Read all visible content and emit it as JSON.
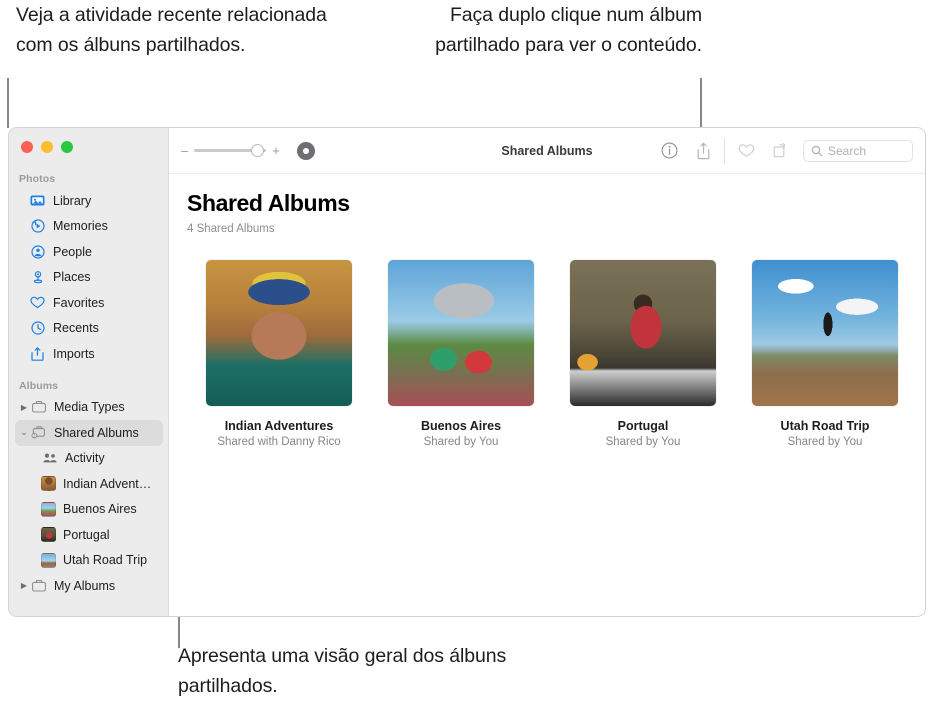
{
  "callouts": {
    "activity": "Veja a atividade recente relacionada com os álbuns partilhados.",
    "double_click": "Faça duplo clique num álbum partilhado para ver o conteúdo.",
    "overview": "Apresenta uma visão geral dos álbuns partilhados."
  },
  "window": {
    "traffic_lights": {
      "close_color": "#ff5f57",
      "minimize_color": "#febc2e",
      "zoom_color": "#28c840"
    }
  },
  "sidebar": {
    "sections": [
      {
        "header": "Photos",
        "items": [
          {
            "label": "Library",
            "icon": "library-icon",
            "selected": false
          },
          {
            "label": "Memories",
            "icon": "memories-icon",
            "selected": false
          },
          {
            "label": "People",
            "icon": "people-icon",
            "selected": false
          },
          {
            "label": "Places",
            "icon": "places-icon",
            "selected": false
          },
          {
            "label": "Favorites",
            "icon": "heart-icon",
            "selected": false
          },
          {
            "label": "Recents",
            "icon": "clock-icon",
            "selected": false
          },
          {
            "label": "Imports",
            "icon": "import-icon",
            "selected": false
          }
        ]
      },
      {
        "header": "Albums",
        "items": [
          {
            "label": "Media Types",
            "icon": "folder-icon",
            "twisty": "▶",
            "selected": false
          },
          {
            "label": "Shared Albums",
            "icon": "shared-folder-icon",
            "twisty": "⌄",
            "selected": true
          },
          {
            "label": "Activity",
            "icon": "activity-icon",
            "sub": true,
            "selected": false
          },
          {
            "label": "Indian Advent…",
            "icon": "album-thumb",
            "sub": true,
            "selected": false
          },
          {
            "label": "Buenos Aires",
            "icon": "album-thumb",
            "sub": true,
            "selected": false
          },
          {
            "label": "Portugal",
            "icon": "album-thumb",
            "sub": true,
            "selected": false
          },
          {
            "label": "Utah Road Trip",
            "icon": "album-thumb",
            "sub": true,
            "selected": false
          },
          {
            "label": "My Albums",
            "icon": "folder-icon",
            "twisty": "▶",
            "selected": false
          }
        ]
      }
    ]
  },
  "toolbar": {
    "zoom_out_label": "–",
    "zoom_in_label": "+",
    "title": "Shared Albums",
    "search_placeholder": "Search"
  },
  "main": {
    "title": "Shared Albums",
    "subtitle": "4 Shared Albums",
    "albums": [
      {
        "name": "Indian Adventures",
        "shared": "Shared with Danny Rico"
      },
      {
        "name": "Buenos Aires",
        "shared": "Shared by You"
      },
      {
        "name": "Portugal",
        "shared": "Shared by You"
      },
      {
        "name": "Utah Road Trip",
        "shared": "Shared by You"
      }
    ]
  }
}
